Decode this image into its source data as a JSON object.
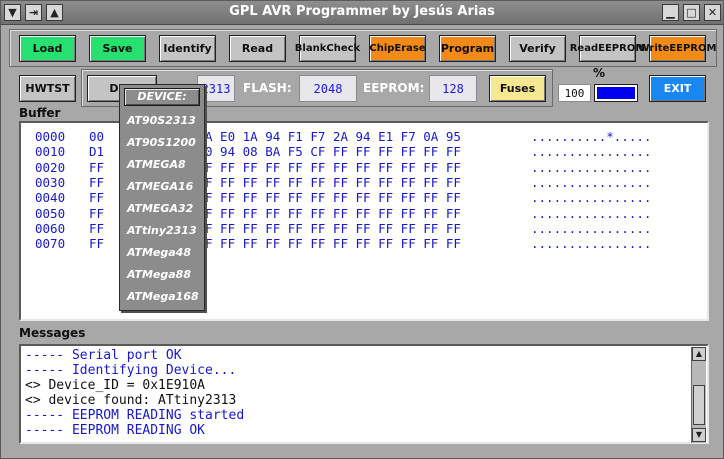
{
  "window": {
    "title": "GPL AVR Programmer by Jesús Arias",
    "controls": {
      "menu_icon": "▼",
      "pin_icon": "⇥",
      "shade_icon": "▲",
      "minimize_icon": "▁",
      "maximize_icon": "□",
      "close_icon": "✕"
    }
  },
  "toolbar": {
    "load": "Load",
    "save": "Save",
    "identify": "Identify",
    "read": "Read",
    "blank_check": "Blank Check",
    "chip_erase": "Chip Erase",
    "program": "Program",
    "verify": "Verify",
    "read_eeprom": "Read EEPROM",
    "write_eeprom": "Write EEPROM"
  },
  "row2": {
    "hwtst": "HWTST",
    "device_button": "DEV",
    "device_value": "2313",
    "flash_label": "FLASH:",
    "flash_value": "2048",
    "eeprom_label": "EEPROM:",
    "eeprom_value": "128",
    "fuses": "Fuses",
    "percent_label": "%",
    "percent_value": "100",
    "exit": "EXIT"
  },
  "buffer": {
    "label": "Buffer",
    "rows": [
      {
        "addr": "0000",
        "visible_left": "00",
        "visible_right": "A E0 1A 94 F1 F7 2A 94 E1 F7 0A 95",
        "ascii": "..........*....."
      },
      {
        "addr": "0010",
        "visible_left": "D1",
        "visible_right": "0 94 08 BA F5 CF FF FF FF FF FF FF",
        "ascii": "................"
      },
      {
        "addr": "0020",
        "visible_left": "FF",
        "visible_right": "F FF FF FF FF FF FF FF FF FF FF FF",
        "ascii": "................"
      },
      {
        "addr": "0030",
        "visible_left": "FF",
        "visible_right": "F FF FF FF FF FF FF FF FF FF FF FF",
        "ascii": "................"
      },
      {
        "addr": "0040",
        "visible_left": "FF",
        "visible_right": "F FF FF FF FF FF FF FF FF FF FF FF",
        "ascii": "................"
      },
      {
        "addr": "0050",
        "visible_left": "FF",
        "visible_right": "F FF FF FF FF FF FF FF FF FF FF FF",
        "ascii": "................"
      },
      {
        "addr": "0060",
        "visible_left": "FF",
        "visible_right": "F FF FF FF FF FF FF FF FF FF FF FF",
        "ascii": "................"
      },
      {
        "addr": "0070",
        "visible_left": "FF",
        "visible_right": "F FF FF FF FF FF FF FF FF FF FF FF",
        "ascii": "................"
      }
    ]
  },
  "messages": {
    "label": "Messages",
    "lines": [
      {
        "text": "----- Serial port OK",
        "color": "#1818c8"
      },
      {
        "text": "----- Identifying Device...",
        "color": "#1818c8"
      },
      {
        "text": "<> Device_ID = 0x1E910A",
        "color": "#101010"
      },
      {
        "text": "<> device found: ATtiny2313",
        "color": "#101010"
      },
      {
        "text": "----- EEPROM READING started",
        "color": "#1818c8"
      },
      {
        "text": "----- EEPROM READING OK",
        "color": "#1818c8"
      }
    ]
  },
  "device_menu": {
    "header": "DEVICE:",
    "items": [
      "AT90S2313",
      "AT90S1200",
      "ATMEGA8",
      "ATMEGA16",
      "ATMEGA32",
      "ATtiny2313",
      "ATMega48",
      "ATMega88",
      "ATMega168"
    ]
  },
  "colors": {
    "green": "#28e070",
    "orange": "#f28a1a",
    "blue": "#1a86f0",
    "yellow": "#f6e890",
    "hex_text": "#1818c8",
    "progress_fill": "#0000ee"
  },
  "progress": {
    "fraction": 1.0
  }
}
